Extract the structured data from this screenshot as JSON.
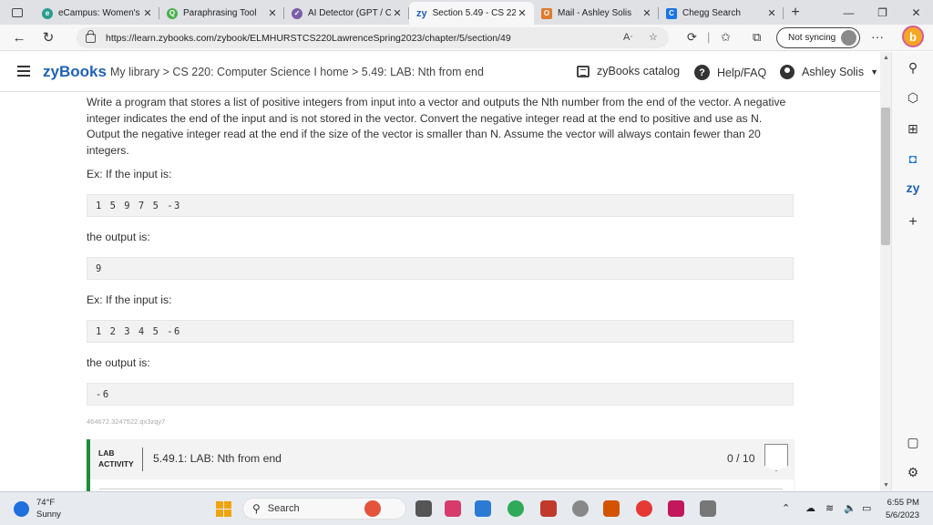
{
  "browser": {
    "tabs": [
      {
        "title": "eCampus: Women's",
        "favicon": "ecampus-icon",
        "color": "#2a9d8f",
        "active": false
      },
      {
        "title": "Paraphrasing Tool",
        "favicon": "quillbot-icon",
        "color": "#4caf50",
        "active": false
      },
      {
        "title": "AI Detector (GPT / C",
        "favicon": "ai-detector-icon",
        "color": "#7b5ea7",
        "active": false
      },
      {
        "title": "Section 5.49 - CS 22",
        "favicon": "zy-icon",
        "color": "#1f62b8",
        "active": true
      },
      {
        "title": "Mail - Ashley Solis",
        "favicon": "outlook-icon",
        "color": "#e07a2e",
        "active": false
      },
      {
        "title": "Chegg Search",
        "favicon": "chegg-icon",
        "color": "#1a73e8",
        "active": false
      }
    ],
    "url": "https://learn.zybooks.com/zybook/ELMHURSTCS220LawrenceSpring2023/chapter/5/section/49",
    "sync_label": "Not syncing"
  },
  "header": {
    "logo": "zyBooks",
    "breadcrumb": "My library > CS 220: Computer Science I home > 5.49: LAB: Nth from end",
    "catalog": "zyBooks catalog",
    "help": "Help/FAQ",
    "user": "Ashley Solis"
  },
  "content": {
    "description": "Write a program that stores a list of positive integers from input into a vector and outputs the Nth number from the end of the vector. A negative integer indicates the end of the input and is not stored in the vector. Convert the negative integer read at the end to positive and use as N. Output the negative integer read at the end if the size of the vector is smaller than N. Assume the vector will always contain fewer than 20 integers.",
    "ex1_label": "Ex: If the input is:",
    "ex1_input": "1 5 9 7 5 -3",
    "ex1_output_label": "the output is:",
    "ex1_output": "9",
    "ex2_label": "Ex: If the input is:",
    "ex2_input": "1 2 3 4 5 -6",
    "ex2_output_label": "the output is:",
    "ex2_output": "-6",
    "identifier": "464672.3247522.qx3zqy7",
    "lab_tag_line1": "LAB",
    "lab_tag_line2": "ACTIVITY",
    "lab_title": "5.49.1: LAB: Nth from end",
    "lab_score": "0 / 10"
  },
  "taskbar": {
    "temperature": "74°F",
    "condition": "Sunny",
    "search": "Search",
    "time": "6:55 PM",
    "date": "5/6/2023"
  },
  "colors": {
    "zybooks_blue": "#1f62b8",
    "lab_green": "#1e8d3c"
  }
}
